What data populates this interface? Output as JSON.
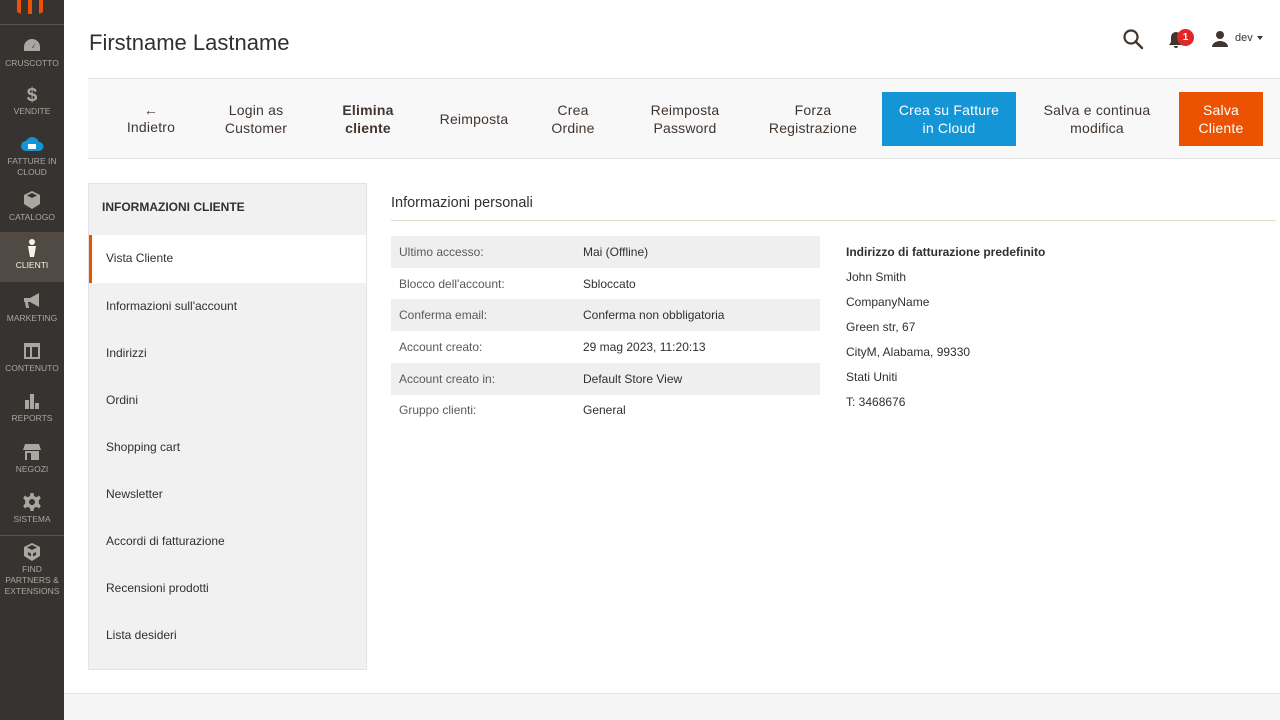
{
  "sidebar": {
    "items": [
      {
        "label": "CRUSCOTTO",
        "icon": "dashboard-icon"
      },
      {
        "label": "VENDITE",
        "icon": "dollar-icon"
      },
      {
        "label": "FATTURE IN CLOUD",
        "icon": "cloud-icon"
      },
      {
        "label": "CATALOGO",
        "icon": "box-icon"
      },
      {
        "label": "CLIENTI",
        "icon": "person-icon"
      },
      {
        "label": "MARKETING",
        "icon": "megaphone-icon"
      },
      {
        "label": "CONTENUTO",
        "icon": "layout-icon"
      },
      {
        "label": "REPORTS",
        "icon": "bar-chart-icon"
      },
      {
        "label": "NEGOZI",
        "icon": "store-icon"
      },
      {
        "label": "SISTEMA",
        "icon": "gear-icon"
      },
      {
        "label": "FIND PARTNERS & EXTENSIONS",
        "icon": "cubes-icon"
      }
    ]
  },
  "header": {
    "title": "Firstname Lastname",
    "notifications_count": "1",
    "username": "dev"
  },
  "actions": {
    "back": "Indietro",
    "login_as": "Login as Customer",
    "delete": "Elimina cliente",
    "reset": "Reimposta",
    "create_order": "Crea Ordine",
    "reset_password": "Reimposta Password",
    "force_registration": "Forza Registrazione",
    "fic_create": "Crea su Fatture in Cloud",
    "save_continue": "Salva e continua modifica",
    "save": "Salva Cliente"
  },
  "tabs": {
    "title": "INFORMAZIONI CLIENTE",
    "items": [
      "Vista Cliente",
      "Informazioni sull'account",
      "Indirizzi",
      "Ordini",
      "Shopping cart",
      "Newsletter",
      "Accordi di fatturazione",
      "Recensioni prodotti",
      "Lista desideri"
    ]
  },
  "personal": {
    "title": "Informazioni personali",
    "rows": [
      {
        "label": "Ultimo accesso:",
        "value": "Mai (Offline)"
      },
      {
        "label": "Blocco dell'account:",
        "value": "Sbloccato"
      },
      {
        "label": "Conferma email:",
        "value": "Conferma non obbligatoria"
      },
      {
        "label": "Account creato:",
        "value": "29 mag 2023, 11:20:13"
      },
      {
        "label": "Account creato in:",
        "value": "Default Store View"
      },
      {
        "label": "Gruppo clienti:",
        "value": "General"
      }
    ]
  },
  "billing": {
    "title": "Indirizzo di fatturazione predefinito",
    "lines": [
      "John Smith",
      "CompanyName",
      "Green str, 67",
      "CityM, Alabama, 99330",
      "Stati Uniti",
      "T: 3468676"
    ]
  },
  "colors": {
    "sidebar_bg": "#373330",
    "accent_orange": "#eb5202",
    "accent_blue": "#1495d5"
  }
}
